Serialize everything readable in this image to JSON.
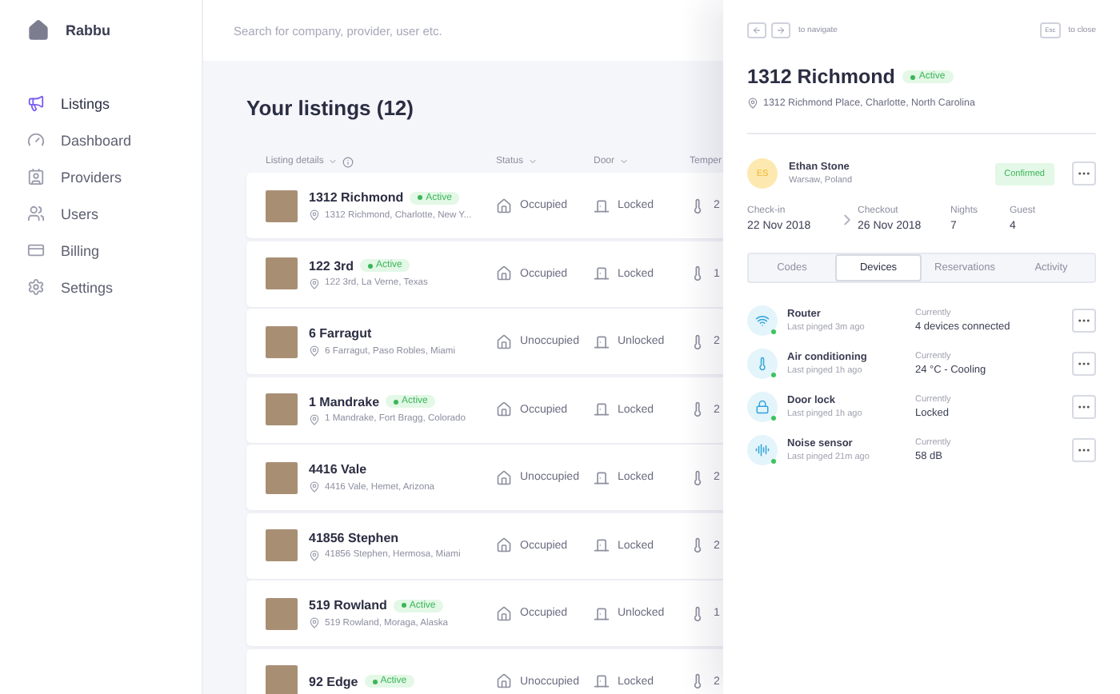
{
  "sidebar": {
    "brand": "Rabbu",
    "items": [
      {
        "kind": "listings",
        "label": "Listings",
        "selected": true
      },
      {
        "kind": "dashboard",
        "label": "Dashboard",
        "selected": false
      },
      {
        "kind": "providers",
        "label": "Providers",
        "selected": false
      },
      {
        "kind": "users",
        "label": "Users",
        "selected": false
      },
      {
        "kind": "billing",
        "label": "Billing",
        "selected": false
      },
      {
        "kind": "settings",
        "label": "Settings",
        "selected": false
      }
    ]
  },
  "search": {
    "placeholder": "Search for company, provider, user etc."
  },
  "listings": {
    "title": "Your listings (12)",
    "columns": [
      "Listing details",
      "Status",
      "Door",
      "Temper"
    ],
    "rows": [
      {
        "name": "1312 Richmond",
        "badge": "Active",
        "address": "1312 Richmond, Charlotte, New Y...",
        "status": "Occupied",
        "door": "Locked",
        "temperature": "2"
      },
      {
        "name": "122 3rd",
        "badge": "Active",
        "address": "122 3rd, La Verne, Texas",
        "status": "Occupied",
        "door": "Locked",
        "temperature": "1"
      },
      {
        "name": "6 Farragut",
        "address": "6 Farragut, Paso Robles, Miami",
        "status": "Unoccupied",
        "door": "Unlocked",
        "temperature": "2"
      },
      {
        "name": "1 Mandrake",
        "badge": "Active",
        "address": "1 Mandrake, Fort Bragg, Colorado",
        "status": "Occupied",
        "door": "Locked",
        "temperature": "2"
      },
      {
        "name": "4416 Vale",
        "address": "4416 Vale, Hemet, Arizona",
        "status": "Unoccupied",
        "door": "Locked",
        "temperature": "2"
      },
      {
        "name": "41856 Stephen",
        "address": "41856 Stephen, Hermosa, Miami",
        "status": "Occupied",
        "door": "Locked",
        "temperature": "2"
      },
      {
        "name": "519 Rowland",
        "badge": "Active",
        "address": "519 Rowland, Moraga, Alaska",
        "status": "Occupied",
        "door": "Unlocked",
        "temperature": "1"
      },
      {
        "name": "92 Edge",
        "badge": "Active",
        "status": "Unoccupied",
        "door": "Locked",
        "temperature": "2"
      }
    ]
  },
  "panel": {
    "nav_hint": "to navigate",
    "close_key": "Esc",
    "close_hint": "to close",
    "title": "1312 Richmond",
    "badge": "Active",
    "address": "1312 Richmond Place, Charlotte, North Carolina",
    "guest": {
      "initials": "ES",
      "name": "Ethan Stone",
      "location": "Warsaw, Poland",
      "status": "Confirmed"
    },
    "stay": [
      {
        "label": "Check-in",
        "value": "22 Nov 2018"
      },
      {
        "label": "Checkout",
        "value": "26 Nov 2018"
      },
      {
        "label": "Nights",
        "value": "7"
      },
      {
        "label": "Guest",
        "value": "4"
      }
    ],
    "tabs": [
      {
        "label": "Codes",
        "selected": false
      },
      {
        "label": "Devices",
        "selected": true
      },
      {
        "label": "Reservations",
        "selected": false
      },
      {
        "label": "Activity",
        "selected": false
      }
    ],
    "devices": [
      {
        "kind": "router",
        "name": "Router",
        "pinged": "Last pinged 3m ago",
        "label": "Currently",
        "value": "4 devices connected",
        "online": true
      },
      {
        "kind": "thermostat",
        "name": "Air conditioning",
        "pinged": "Last pinged 1h ago",
        "label": "Currently",
        "value": "24 °C - Cooling",
        "online": true
      },
      {
        "kind": "lock",
        "name": "Door lock",
        "pinged": "Last pinged 1h ago",
        "label": "Currently",
        "value": "Locked",
        "online": true
      },
      {
        "kind": "sensor",
        "name": "Noise sensor",
        "pinged": "Last pinged 21m ago",
        "label": "Currently",
        "value": "58 dB",
        "online": true
      }
    ]
  }
}
